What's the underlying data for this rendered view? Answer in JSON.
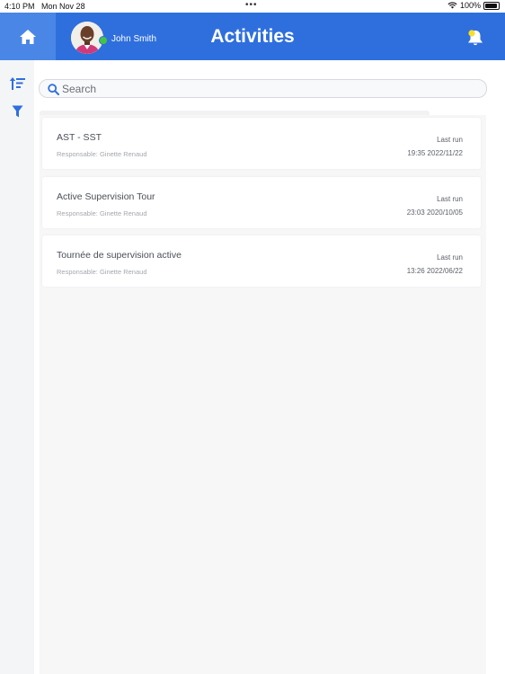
{
  "status_bar": {
    "time": "4:10 PM",
    "date": "Mon Nov 28",
    "dots": "•••",
    "battery": "100%"
  },
  "header": {
    "user_name": "John Smith",
    "title": "Activities",
    "background": "#2f6fdd"
  },
  "search": {
    "placeholder": "Search",
    "value": ""
  },
  "activities": [
    {
      "name": "AST - SST",
      "responsible": "Responsable: Ginette Renaud",
      "last_run_label": "Last run",
      "last_run": "19:35 2022/11/22"
    },
    {
      "name": "Active Supervision Tour",
      "responsible": "Responsable: Ginette Renaud",
      "last_run_label": "Last run",
      "last_run": "23:03 2020/10/05"
    },
    {
      "name": "Tournée de supervision active",
      "responsible": "Responsable: Ginette Renaud",
      "last_run_label": "Last run",
      "last_run": "13:26 2022/06/22"
    }
  ],
  "icons": {
    "home": "home-icon",
    "bell": "bell-icon",
    "sort": "sort-icon",
    "filter": "filter-icon",
    "search": "search-icon"
  }
}
